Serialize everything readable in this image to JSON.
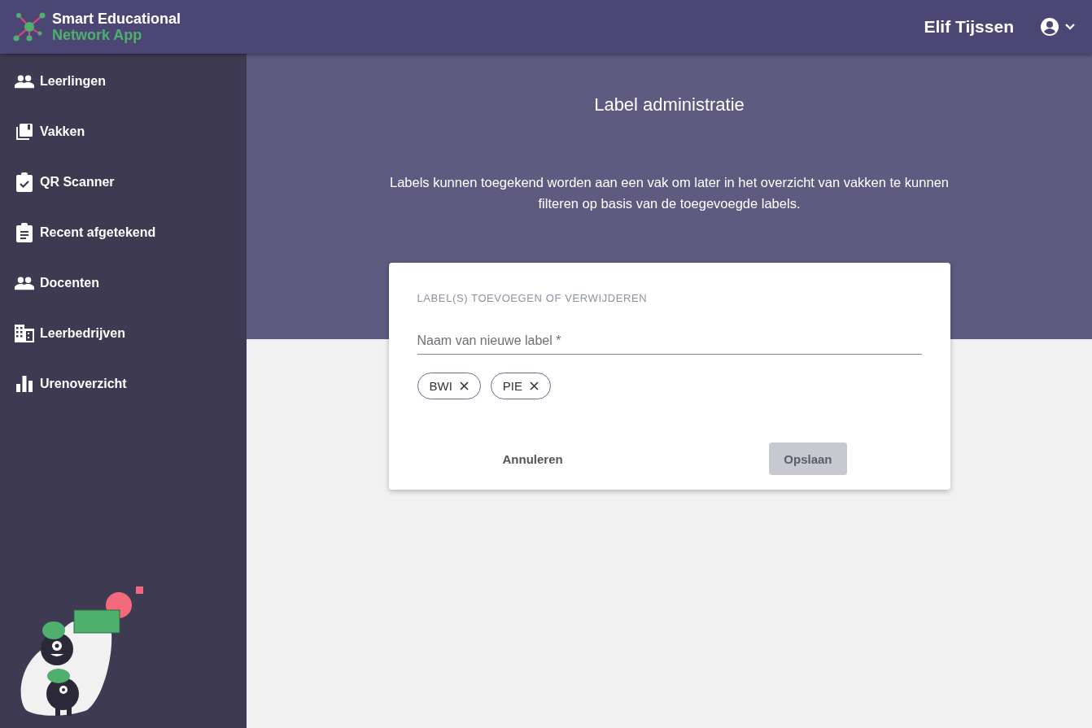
{
  "header": {
    "logo_lines": [
      "Smart Educational",
      "Network App"
    ],
    "user_name": "Elif Tijssen"
  },
  "sidebar": {
    "items": [
      {
        "label": "Leerlingen"
      },
      {
        "label": "Vakken"
      },
      {
        "label": "QR Scanner"
      },
      {
        "label": "Recent afgetekend"
      },
      {
        "label": "Docenten"
      },
      {
        "label": "Leerbedrijven"
      },
      {
        "label": "Urenoverzicht"
      }
    ]
  },
  "page": {
    "title": "Label administratie",
    "description": "Labels kunnen toegekend worden aan een vak om later in het overzicht van vakken te kunnen filteren op basis van de toegevoegde labels."
  },
  "card": {
    "heading": "LABEL(S) TOEVOEGEN OF VERWIJDEREN",
    "field": {
      "placeholder": "Naam van nieuwe label *"
    },
    "chips": [
      {
        "label": "BWI"
      },
      {
        "label": "PIE"
      }
    ],
    "buttons": [
      {
        "label": "Annuleren",
        "disabled": false
      },
      {
        "label": "Opslaan",
        "disabled": true
      }
    ]
  }
}
